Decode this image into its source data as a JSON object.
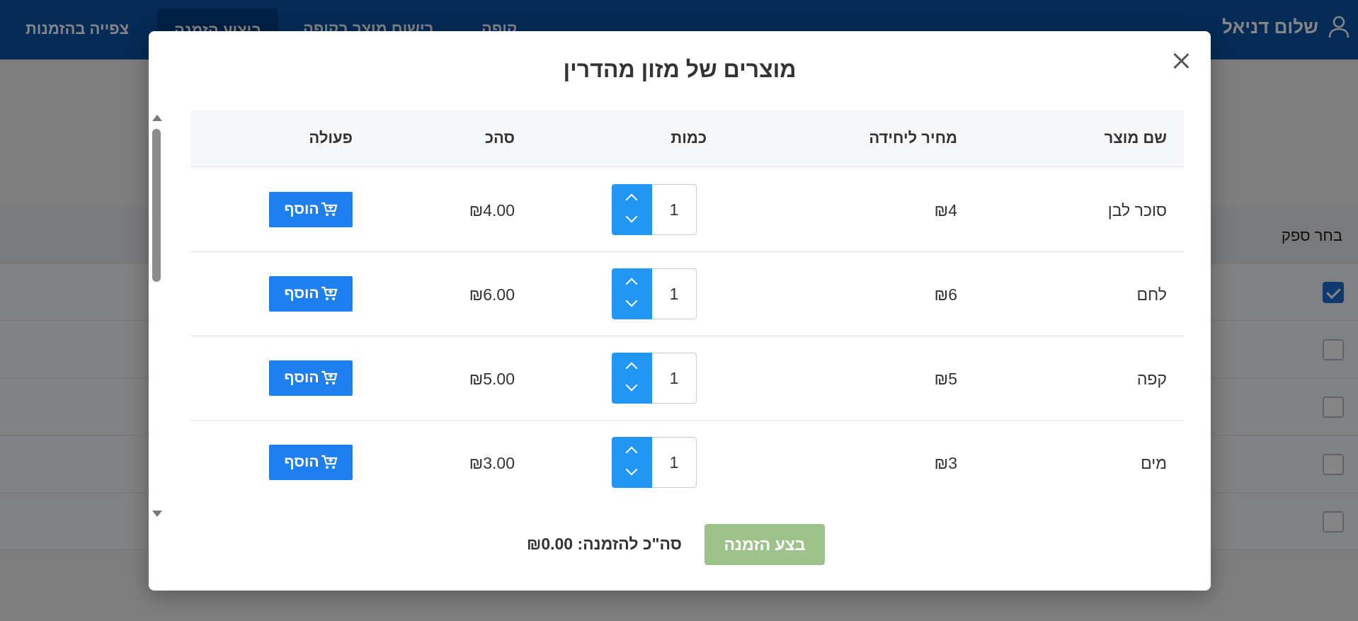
{
  "nav": {
    "user_name": "שלום דניאל",
    "links": [
      "צפייה בהזמנות",
      "ביצוע הזמנה",
      "רישום מוצר בקופה",
      "קופה"
    ]
  },
  "background": {
    "choose_supplier_label": "בחר ספק",
    "rows_checked": [
      true,
      false,
      false,
      false,
      false
    ]
  },
  "modal": {
    "title": "מוצרים של מזון מהדרין",
    "columns": {
      "product": "שם מוצר",
      "unit_price": "מחיר ליחידה",
      "quantity": "כמות",
      "total": "סהכ",
      "action": "פעולה"
    },
    "rows": [
      {
        "name": "סוכר לבן",
        "price": "₪4",
        "qty": "1",
        "total": "₪4.00",
        "action": "הוסף"
      },
      {
        "name": "לחם",
        "price": "₪6",
        "qty": "1",
        "total": "₪6.00",
        "action": "הוסף"
      },
      {
        "name": "קפה",
        "price": "₪5",
        "qty": "1",
        "total": "₪5.00",
        "action": "הוסף"
      },
      {
        "name": "מים",
        "price": "₪3",
        "qty": "1",
        "total": "₪3.00",
        "action": "הוסף"
      }
    ],
    "order_button": "בצע הזמנה",
    "order_total": "סה\"כ להזמנה: ₪0.00"
  },
  "colors": {
    "navbar": "#0a54a8",
    "primary": "#2196f3",
    "add_button": "#1e7ff0",
    "order_button_disabled": "#9dc28a"
  }
}
